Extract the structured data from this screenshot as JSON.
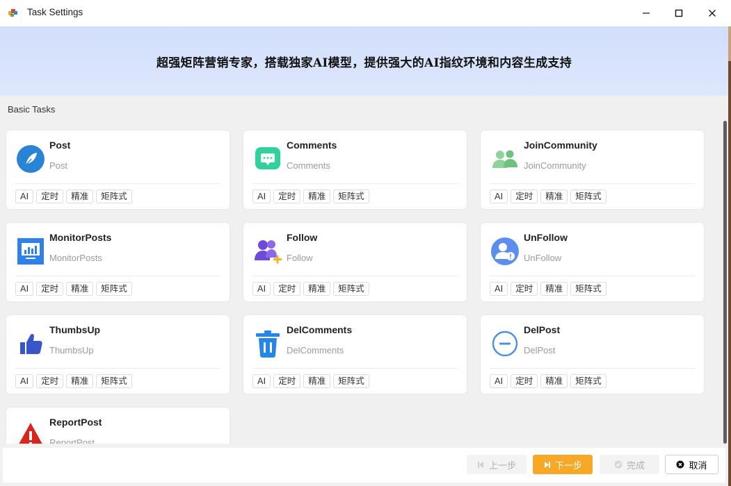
{
  "window": {
    "title": "Task Settings"
  },
  "banner": {
    "text": "超强矩阵营销专家，搭载独家AI模型，提供强大的AI指纹环境和内容生成支持"
  },
  "section": {
    "label": "Basic Tasks"
  },
  "tags": [
    "AI",
    "定时",
    "精准",
    "矩阵式"
  ],
  "colors": {
    "accent": "#f7a826",
    "banner": "#d2dffb"
  },
  "cards": [
    {
      "title": "Post",
      "subtitle": "Post",
      "icon": "feather-icon"
    },
    {
      "title": "Comments",
      "subtitle": "Comments",
      "icon": "comment-icon"
    },
    {
      "title": "JoinCommunity",
      "subtitle": "JoinCommunity",
      "icon": "community-icon"
    },
    {
      "title": "MonitorPosts",
      "subtitle": "MonitorPosts",
      "icon": "monitor-icon"
    },
    {
      "title": "Follow",
      "subtitle": "Follow",
      "icon": "follow-icon"
    },
    {
      "title": "UnFollow",
      "subtitle": "UnFollow",
      "icon": "unfollow-icon"
    },
    {
      "title": "ThumbsUp",
      "subtitle": "ThumbsUp",
      "icon": "thumbs-up-icon"
    },
    {
      "title": "DelComments",
      "subtitle": "DelComments",
      "icon": "trash-icon"
    },
    {
      "title": "DelPost",
      "subtitle": "DelPost",
      "icon": "minus-circle-icon"
    },
    {
      "title": "ReportPost",
      "subtitle": "ReportPost",
      "icon": "warning-icon"
    }
  ],
  "footer": {
    "prev": "上一步",
    "next": "下一步",
    "done": "完成",
    "cancel": "取消"
  }
}
